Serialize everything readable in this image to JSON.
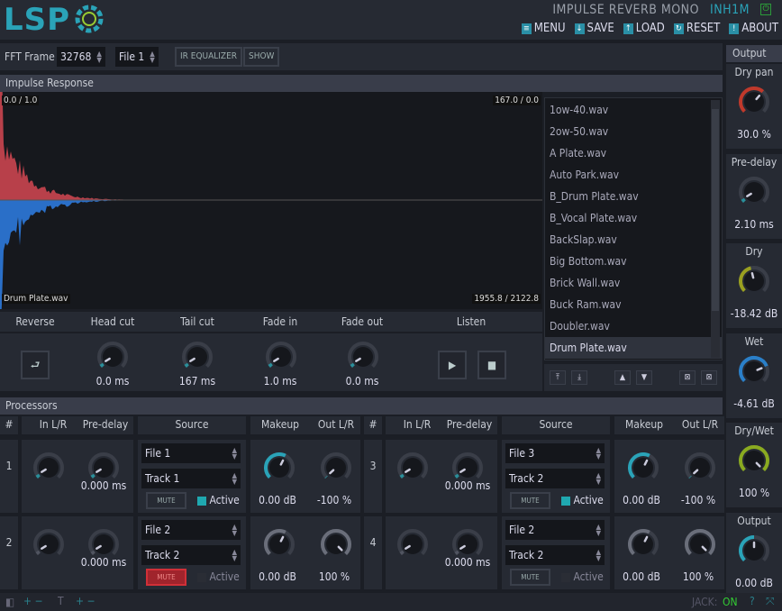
{
  "header": {
    "logo": "LSP",
    "plugin_title": "IMPULSE REVERB MONO",
    "instance": "INH1M",
    "menu": [
      {
        "label": "MENU",
        "icon": "menu-icon"
      },
      {
        "label": "SAVE",
        "icon": "save-icon"
      },
      {
        "label": "LOAD",
        "icon": "load-icon"
      },
      {
        "label": "RESET",
        "icon": "reset-icon"
      },
      {
        "label": "ABOUT",
        "icon": "about-icon"
      }
    ]
  },
  "toolbar": {
    "fft_label": "FFT Frame",
    "fft_value": "32768",
    "file_value": "File 1",
    "ir_eq": "IR EQUALIZER",
    "show": "SHOW"
  },
  "impulse": {
    "title": "Impulse Response",
    "tl": "0.0 / 1.0",
    "tr": "167.0 / 0.0",
    "bl": "Drum Plate.wav",
    "br": "1955.8 / 2122.8",
    "colors": {
      "positive": "#b8404a",
      "negative": "#2a6fc8"
    }
  },
  "files": [
    "1ow-40.wav",
    "2ow-50.wav",
    "A Plate.wav",
    "Auto Park.wav",
    "B_Drum Plate.wav",
    "B_Vocal Plate.wav",
    "BackSlap.wav",
    "Big Bottom.wav",
    "Brick Wall.wav",
    "Buck Ram.wav",
    "Doubler.wav",
    "Drum Plate.wav"
  ],
  "selected_file": "Drum Plate.wav",
  "controls": {
    "reverse": "Reverse",
    "head_cut": "Head cut",
    "tail_cut": "Tail cut",
    "fade_in": "Fade in",
    "fade_out": "Fade out",
    "listen": "Listen",
    "head_val": "0.0 ms",
    "tail_val": "167 ms",
    "fadein_val": "1.0 ms",
    "fadeout_val": "0.0 ms"
  },
  "processors": {
    "title": "Processors",
    "headers": {
      "num": "#",
      "in": "In L/R",
      "pre": "Pre-delay",
      "source": "Source",
      "makeup": "Makeup",
      "out": "Out L/R"
    },
    "rows": [
      {
        "num": "1",
        "predelay": "0.000 ms",
        "file": "File 1",
        "track": "Track 1",
        "mute": "MUTE",
        "muted": false,
        "active_label": "Active",
        "active": true,
        "makeup": "0.00 dB",
        "out": "-100 %"
      },
      {
        "num": "2",
        "predelay": "0.000 ms",
        "file": "File 2",
        "track": "Track 2",
        "mute": "MUTE",
        "muted": true,
        "active_label": "Active",
        "active": false,
        "makeup": "0.00 dB",
        "out": "100 %"
      },
      {
        "num": "3",
        "predelay": "0.000 ms",
        "file": "File 3",
        "track": "Track 2",
        "mute": "MUTE",
        "muted": false,
        "active_label": "Active",
        "active": true,
        "makeup": "0.00 dB",
        "out": "-100 %"
      },
      {
        "num": "4",
        "predelay": "0.000 ms",
        "file": "File 2",
        "track": "Track 2",
        "mute": "MUTE",
        "muted": false,
        "active_label": "Active",
        "active": false,
        "makeup": "0.00 dB",
        "out": "100 %"
      }
    ]
  },
  "output": {
    "title": "Output",
    "items": [
      {
        "label": "Dry pan",
        "value": "30.0 %",
        "level": 0.65,
        "color": "#c0392b"
      },
      {
        "label": "Pre-delay",
        "value": "2.10 ms",
        "level": 0.05,
        "color": "#2a8f9a"
      },
      {
        "label": "Dry",
        "value": "-18.42 dB",
        "level": 0.45,
        "color": "#9aa020"
      },
      {
        "label": "Wet",
        "value": "-4.61 dB",
        "level": 0.75,
        "color": "#2a7fc8"
      },
      {
        "label": "Dry/Wet",
        "value": "100 %",
        "level": 1.0,
        "color": "#8aaa20"
      },
      {
        "label": "Output",
        "value": "0.00 dB",
        "level": 0.5,
        "color": "#2aa3b8"
      }
    ]
  },
  "footer": {
    "jack_label": "JACK:",
    "jack_state": "ON"
  }
}
